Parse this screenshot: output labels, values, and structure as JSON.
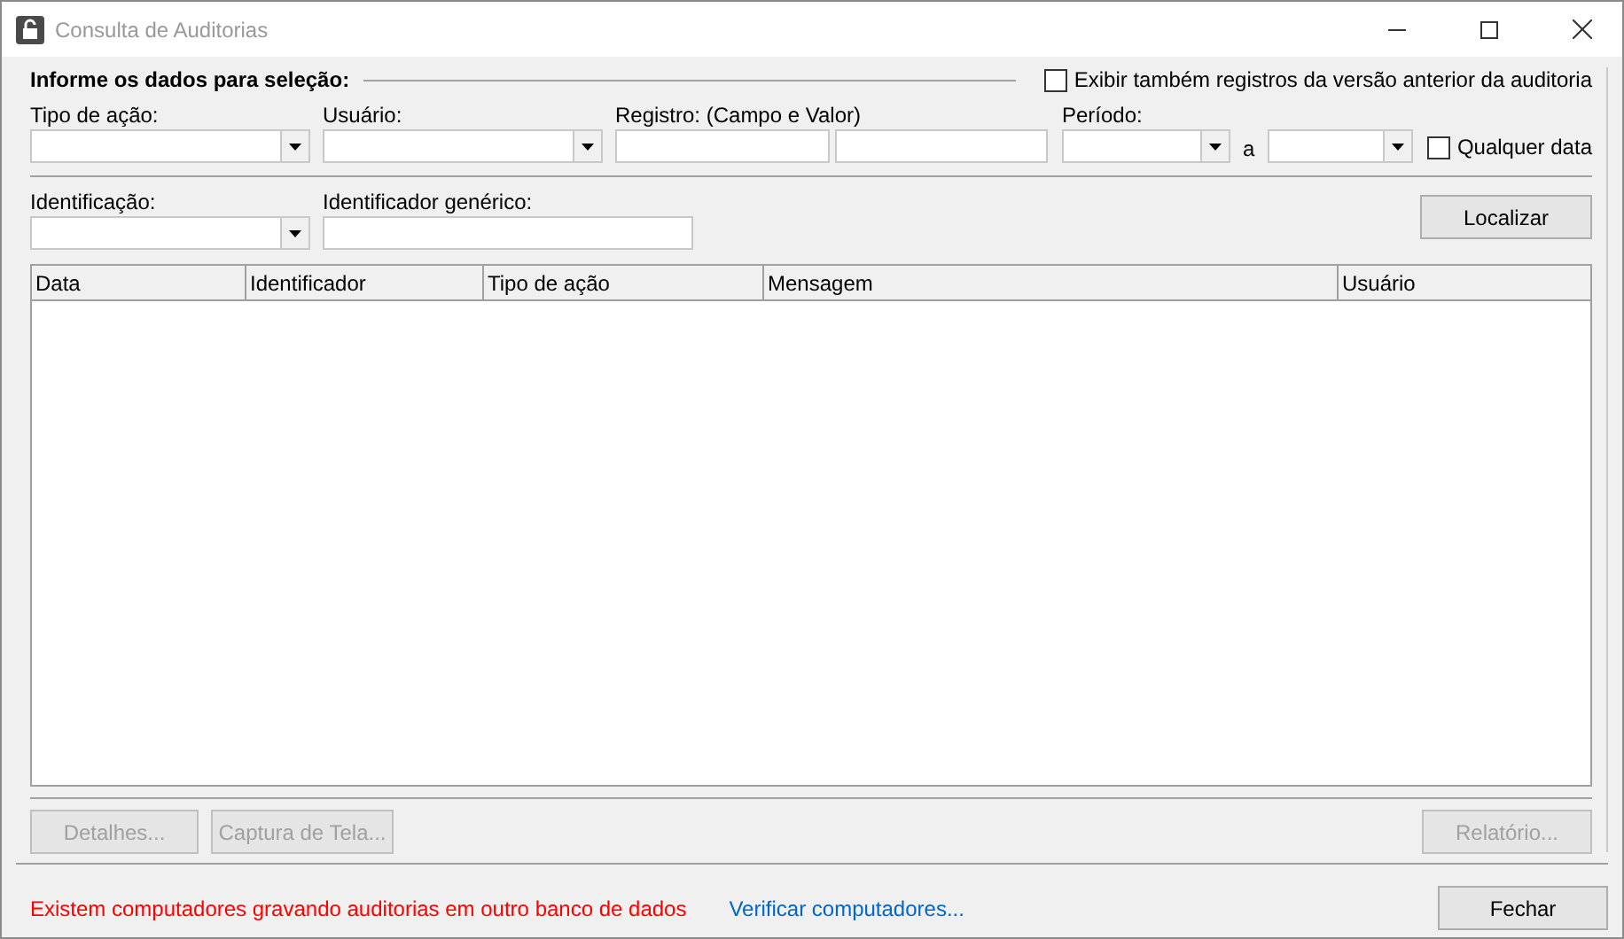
{
  "window": {
    "title": "Consulta de Auditorias"
  },
  "group_title": "Informe os dados para seleção:",
  "show_previous": {
    "label": "Exibir também registros da versão anterior da auditoria",
    "checked": false
  },
  "action_type": {
    "label": "Tipo de ação:"
  },
  "user": {
    "label": "Usuário:"
  },
  "record": {
    "label": "Registro: (Campo e Valor)"
  },
  "period": {
    "label": "Período:",
    "separator": "a"
  },
  "any_date": {
    "label": "Qualquer data",
    "checked": false
  },
  "identification": {
    "label": "Identificação:"
  },
  "generic_id": {
    "label": "Identificador genérico:"
  },
  "search_button": {
    "label": "Localizar",
    "disabled": false
  },
  "table": {
    "columns": [
      "Data",
      "Identificador",
      "Tipo de ação",
      "Mensagem",
      "Usuário"
    ]
  },
  "action_buttons": [
    {
      "label": "Detalhes...",
      "disabled": true
    },
    {
      "label": "Captura de Tela...",
      "disabled": true
    },
    {
      "label": "Relatório...",
      "disabled": true
    }
  ],
  "warning": "Existem computadores gravando auditorias em outro banco de dados",
  "check_link": "Verificar computadores...",
  "close_button": {
    "label": "Fechar",
    "disabled": false
  }
}
